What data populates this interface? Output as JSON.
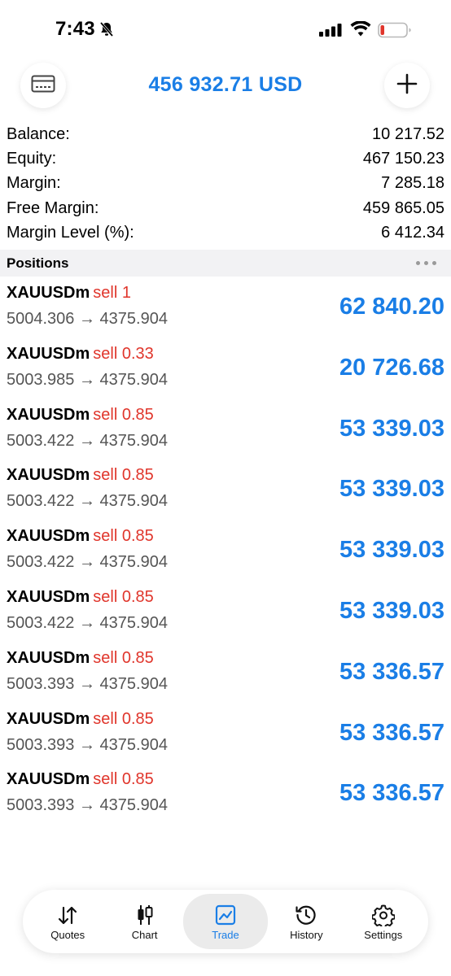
{
  "status_bar": {
    "time": "7:43"
  },
  "header": {
    "equity_title": "456 932.71 USD"
  },
  "summary": [
    {
      "label": "Balance:",
      "value": "10 217.52"
    },
    {
      "label": "Equity:",
      "value": "467 150.23"
    },
    {
      "label": "Margin:",
      "value": "7 285.18"
    },
    {
      "label": "Free Margin:",
      "value": "459 865.05"
    },
    {
      "label": "Margin Level (%):",
      "value": "6 412.34"
    }
  ],
  "positions_label": "Positions",
  "positions": [
    {
      "symbol": "XAUUSDm",
      "side": "sell 1",
      "prices": "5004.306 → 4375.904",
      "profit": "62 840.20"
    },
    {
      "symbol": "XAUUSDm",
      "side": "sell 0.33",
      "prices": "5003.985 → 4375.904",
      "profit": "20 726.68"
    },
    {
      "symbol": "XAUUSDm",
      "side": "sell 0.85",
      "prices": "5003.422 → 4375.904",
      "profit": "53 339.03"
    },
    {
      "symbol": "XAUUSDm",
      "side": "sell 0.85",
      "prices": "5003.422 → 4375.904",
      "profit": "53 339.03"
    },
    {
      "symbol": "XAUUSDm",
      "side": "sell 0.85",
      "prices": "5003.422 → 4375.904",
      "profit": "53 339.03"
    },
    {
      "symbol": "XAUUSDm",
      "side": "sell 0.85",
      "prices": "5003.422 → 4375.904",
      "profit": "53 339.03"
    },
    {
      "symbol": "XAUUSDm",
      "side": "sell 0.85",
      "prices": "5003.393 → 4375.904",
      "profit": "53 336.57"
    },
    {
      "symbol": "XAUUSDm",
      "side": "sell 0.85",
      "prices": "5003.393 → 4375.904",
      "profit": "53 336.57"
    },
    {
      "symbol": "XAUUSDm",
      "side": "sell 0.85",
      "prices": "5003.393 → 4375.904",
      "profit": "53 336.57"
    }
  ],
  "tabs": [
    {
      "label": "Quotes",
      "icon": "quotes-arrows-icon",
      "active": false
    },
    {
      "label": "Chart",
      "icon": "candlestick-icon",
      "active": false
    },
    {
      "label": "Trade",
      "icon": "trade-chart-icon",
      "active": true
    },
    {
      "label": "History",
      "icon": "history-clock-icon",
      "active": false
    },
    {
      "label": "Settings",
      "icon": "gear-icon",
      "active": false
    }
  ],
  "colors": {
    "accent": "#1a7ee6",
    "sell": "#e0352b",
    "battery_low": "#e0352b"
  }
}
